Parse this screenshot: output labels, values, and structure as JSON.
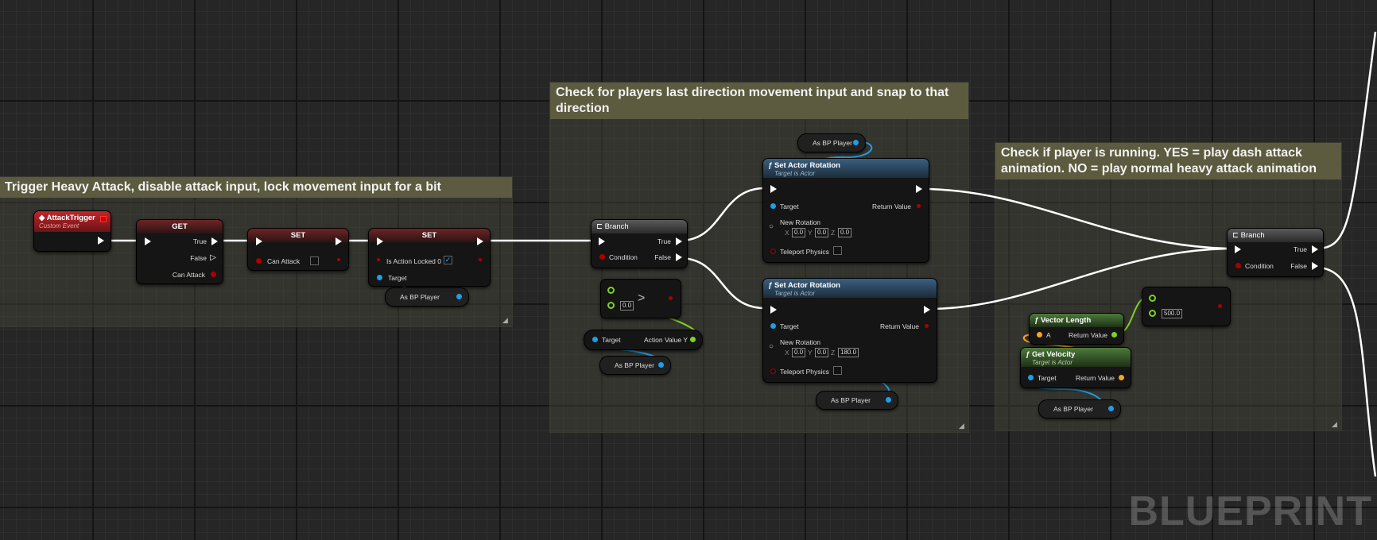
{
  "comments": {
    "c1": "Trigger Heavy Attack, disable attack input, lock movement input for a bit",
    "c2": "Check for players last direction movement input and snap to that direction",
    "c3": "Check if player is running. YES = play dash attack animation. NO = play normal heavy attack animation"
  },
  "nodes": {
    "event": {
      "title": "AttackTrigger",
      "subtitle": "Custom Event"
    },
    "get": {
      "title": "GET",
      "true_label": "True",
      "false_label": "False",
      "var_label": "Can Attack"
    },
    "set1": {
      "title": "SET",
      "var_label": "Can Attack"
    },
    "set2": {
      "title": "SET",
      "var_label": "Is Action Locked 0",
      "target_label": "Target"
    },
    "branch1": {
      "title": "Branch",
      "condition": "Condition",
      "true_label": "True",
      "false_label": "False"
    },
    "greater": {
      "symbol": ">",
      "value": "0.0"
    },
    "axis": {
      "target_label": "Target",
      "output_label": "Action Value Y"
    },
    "rot1": {
      "title": "Set Actor Rotation",
      "subtitle": "Target is Actor",
      "target": "Target",
      "return": "Return Value",
      "new_rotation": "New Rotation",
      "x": "0.0",
      "y": "0.0",
      "z": "0.0",
      "teleport": "Teleport Physics"
    },
    "rot2": {
      "title": "Set Actor Rotation",
      "subtitle": "Target is Actor",
      "target": "Target",
      "return": "Return Value",
      "new_rotation": "New Rotation",
      "x": "0.0",
      "y": "0.0",
      "z": "180.0",
      "teleport": "Teleport Physics"
    },
    "branch2": {
      "title": "Branch",
      "condition": "Condition",
      "true_label": "True",
      "false_label": "False"
    },
    "greater2": {
      "value": "500.0"
    },
    "vlen": {
      "title": "Vector Length",
      "a": "A",
      "return": "Return Value"
    },
    "vel": {
      "title": "Get Velocity",
      "subtitle": "Target is Actor",
      "target": "Target",
      "return": "Return Value"
    }
  },
  "variables": {
    "bp_player": "As BP Player"
  },
  "axis_letters": {
    "x": "X",
    "y": "Y",
    "z": "Z"
  },
  "watermark": "BLUEPRINT"
}
